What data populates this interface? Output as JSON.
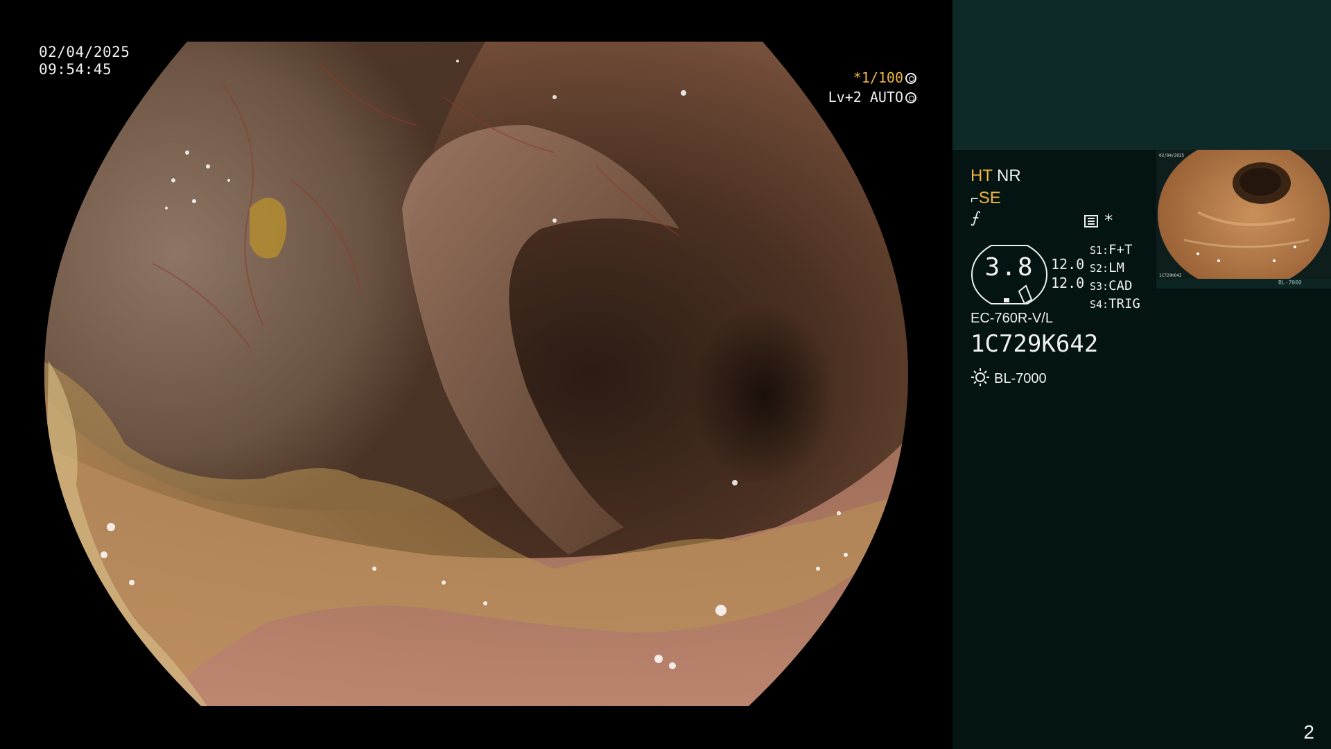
{
  "datetime": {
    "date": "02/04/2025",
    "time": "09:54:45"
  },
  "overlay": {
    "shutter": "*1/100",
    "level_auto": "Lv+2 AUTO",
    "icons": [
      "aperture-icon",
      "target-icon"
    ]
  },
  "panel": {
    "ht_label": "HT",
    "nr_label": "NR",
    "se_label": "SE",
    "gauge_value": "3.8",
    "gauge_val_1": "12.0",
    "gauge_val_2": "12.0",
    "s_keys": [
      "S1:",
      "S2:",
      "S3:",
      "S4:"
    ],
    "s_values": [
      "F+T",
      "LM",
      "CAD",
      "TRIG"
    ],
    "scope_model": "EC-760R-V/L",
    "serial": "1C729K642",
    "light_source": "BL-7000",
    "asterisk": "*"
  },
  "thumbnail": {
    "date": "02/04/2025",
    "serial": "1C729K642",
    "light": "BL-7000"
  },
  "page_number": "2",
  "colors": {
    "accent_yellow": "#f2b640",
    "panel_bg": "#041412",
    "panel_top_bg": "#0e2a28",
    "text": "#f0f0f0"
  }
}
